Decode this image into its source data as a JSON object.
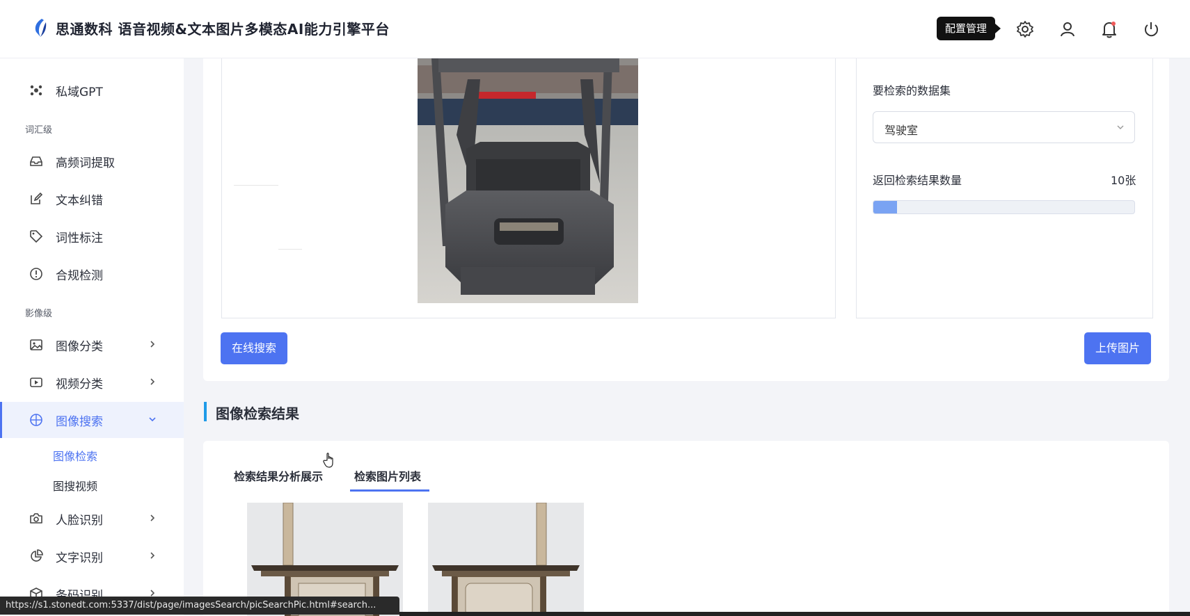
{
  "header": {
    "title": "思通数科 语音视频&文本图片多模态AI能力引擎平台",
    "tooltip": "配置管理"
  },
  "sidebar": {
    "items_top": [
      {
        "label": "私域GPT",
        "icon": "nodes-icon"
      }
    ],
    "section_lexical": "词汇级",
    "lexical_items": [
      {
        "label": "高频词提取",
        "icon": "inbox-icon"
      },
      {
        "label": "文本纠错",
        "icon": "edit-icon"
      },
      {
        "label": "词性标注",
        "icon": "tag-icon"
      },
      {
        "label": "合规检测",
        "icon": "alert-circle-icon"
      }
    ],
    "section_image": "影像级",
    "image_items": [
      {
        "label": "图像分类",
        "icon": "image-icon"
      },
      {
        "label": "视频分类",
        "icon": "play-icon"
      },
      {
        "label": "图像搜索",
        "icon": "crosshair-icon"
      }
    ],
    "sub_items": [
      {
        "label": "图像检索"
      },
      {
        "label": "图搜视频"
      }
    ],
    "more_items": [
      {
        "label": "人脸识别",
        "icon": "camera-icon"
      },
      {
        "label": "文字识别",
        "icon": "pie-icon"
      },
      {
        "label": "条码识别",
        "icon": "box-icon"
      }
    ]
  },
  "search_panel": {
    "dataset_label": "要检索的数据集",
    "dataset_value": "驾驶室",
    "count_label": "返回检索结果数量",
    "count_value": "10张",
    "count_fraction": 0.09,
    "online_search_button": "在线搜索",
    "upload_button": "上传图片"
  },
  "results": {
    "heading": "图像检索结果",
    "tabs": [
      {
        "label": "检索结果分析展示"
      },
      {
        "label": "检索图片列表"
      }
    ]
  },
  "statusbar": {
    "url": "https://s1.stonedt.com:5337/dist/page/imagesSearch/picSearchPic.html#search..."
  }
}
